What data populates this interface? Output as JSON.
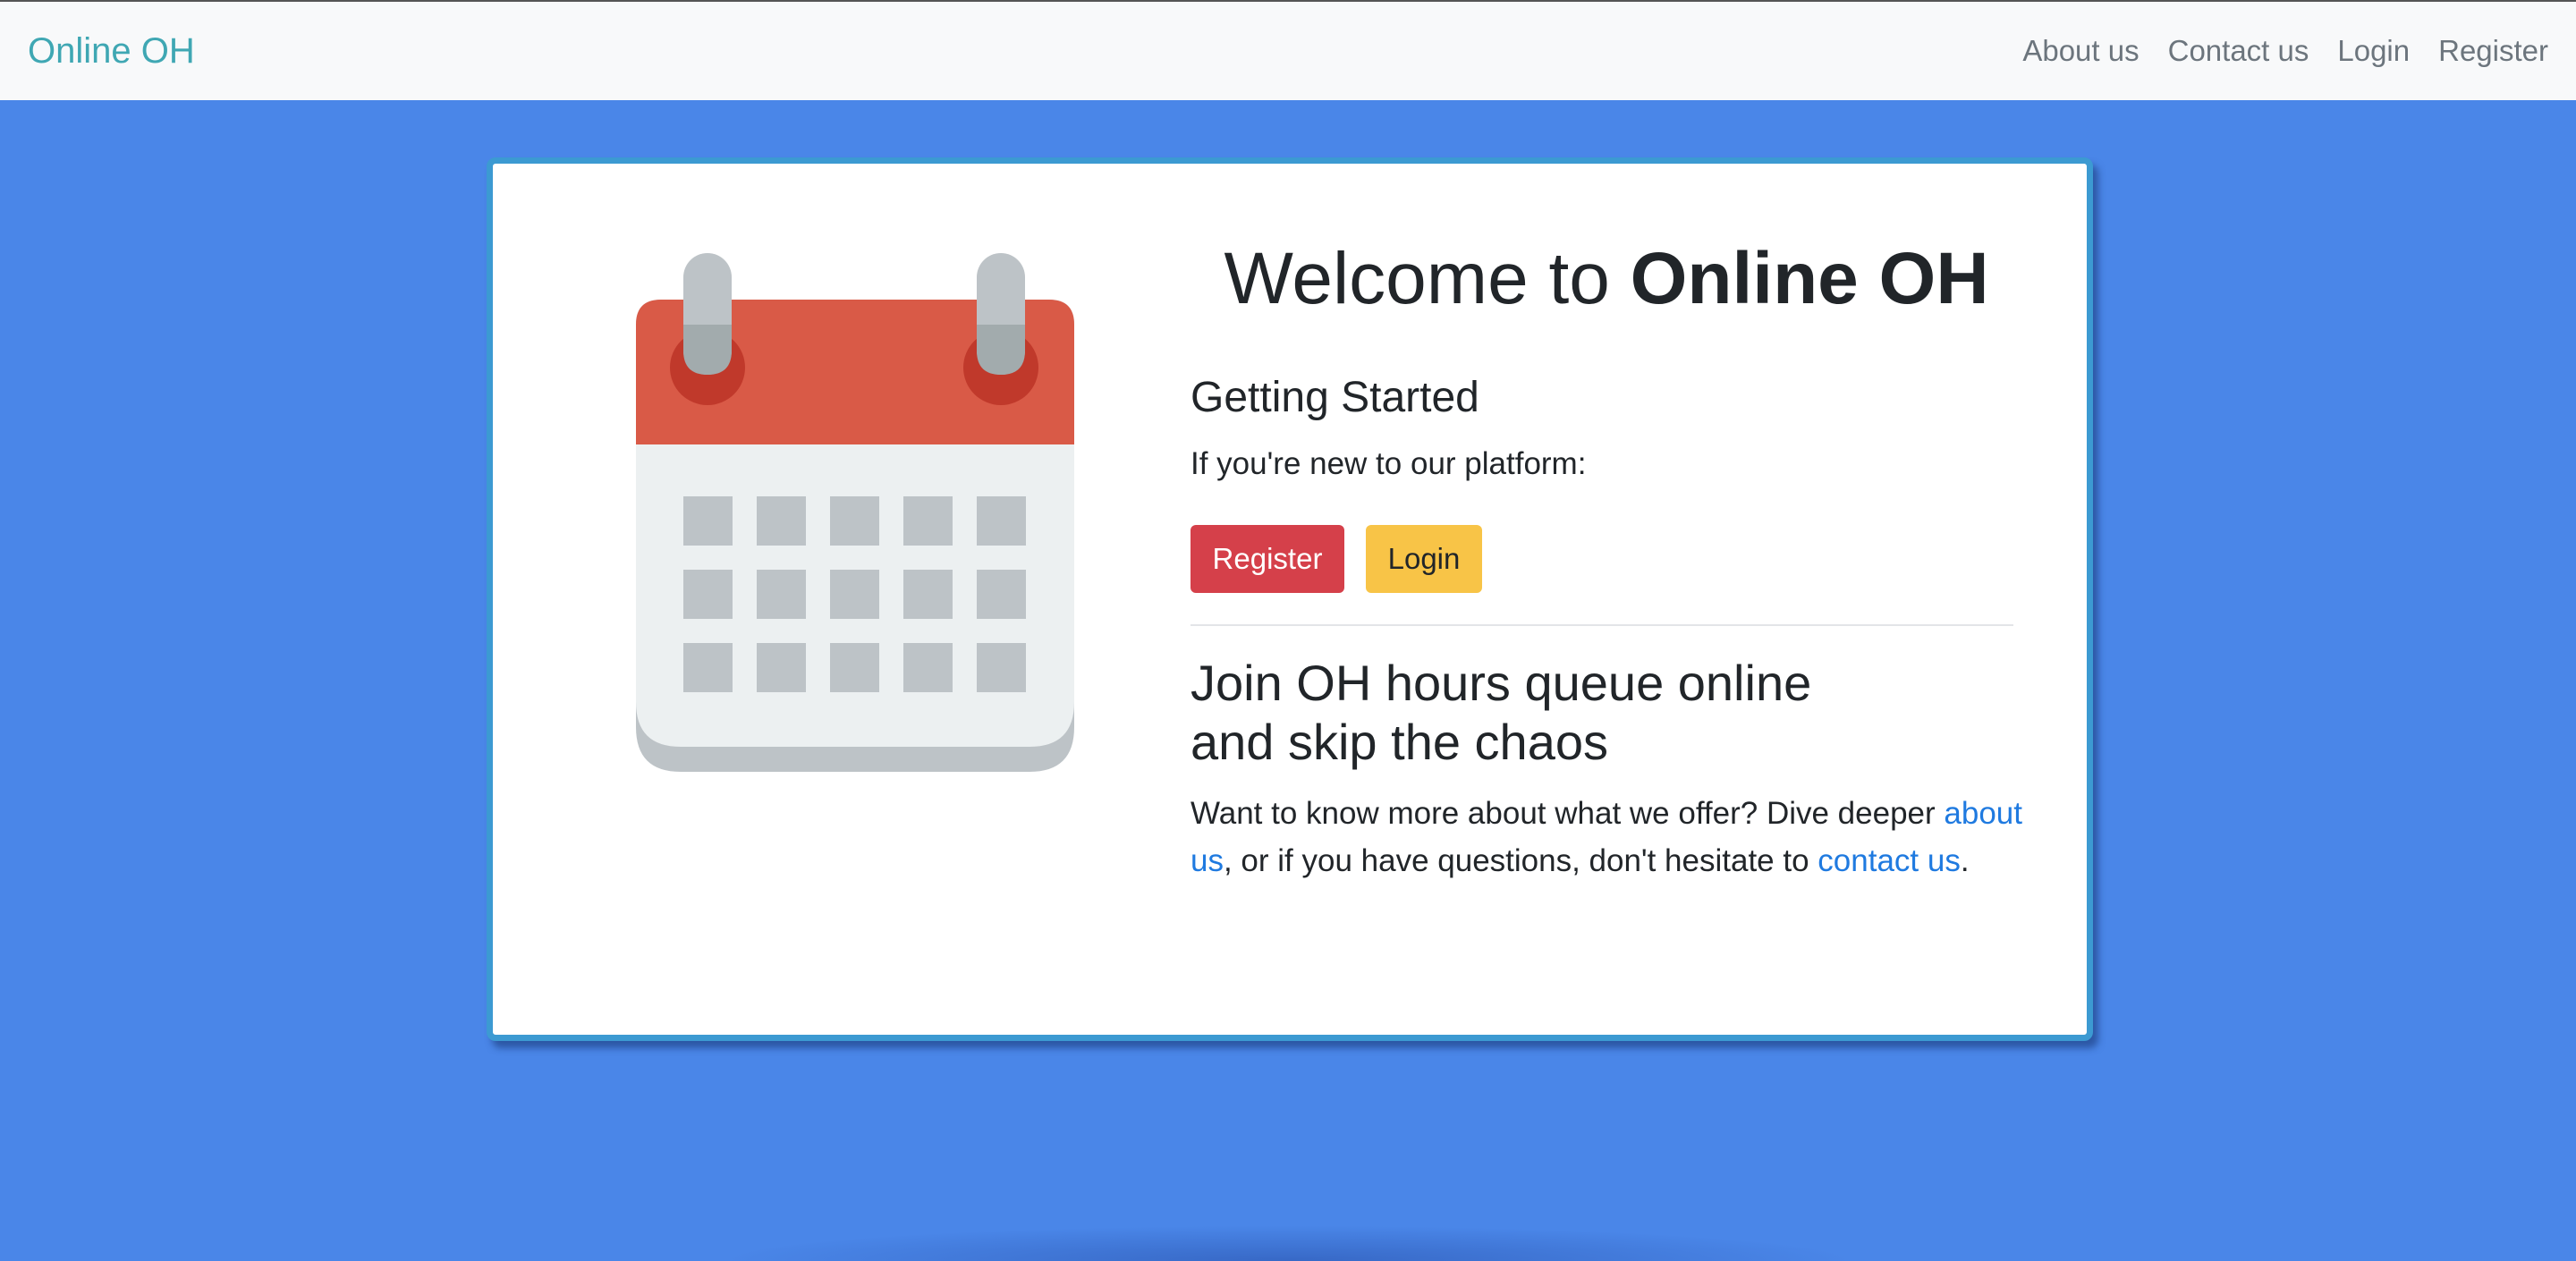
{
  "navbar": {
    "brand": "Online OH",
    "links": [
      "About us",
      "Contact us",
      "Login",
      "Register"
    ]
  },
  "hero": {
    "welcome_prefix": "Welcome to ",
    "welcome_brand": "Online OH",
    "getting_started": "Getting Started",
    "intro": "If you're new to our platform:",
    "register_button": "Register",
    "login_button": "Login",
    "join_line1": "Join OH hours queue online",
    "join_line2": "and skip the chaos",
    "desc_part1": "Want to know more about what we offer? Dive deeper ",
    "desc_link_about": "about us",
    "desc_part2": ", or if you have questions, don't hesitate to ",
    "desc_link_contact": "contact us",
    "desc_part3": "."
  },
  "illustration": {
    "icon": "calendar-icon"
  },
  "colors": {
    "page_background": "#4a86e8",
    "navbar_background": "#f8f9fa",
    "brand": "#3fa7b3",
    "card_border": "#3c9ad2",
    "register": "#d5404a",
    "login": "#f8c447",
    "link": "#1f7ae0",
    "calendar_header": "#d95a47",
    "calendar_body": "#ecf0f1"
  }
}
